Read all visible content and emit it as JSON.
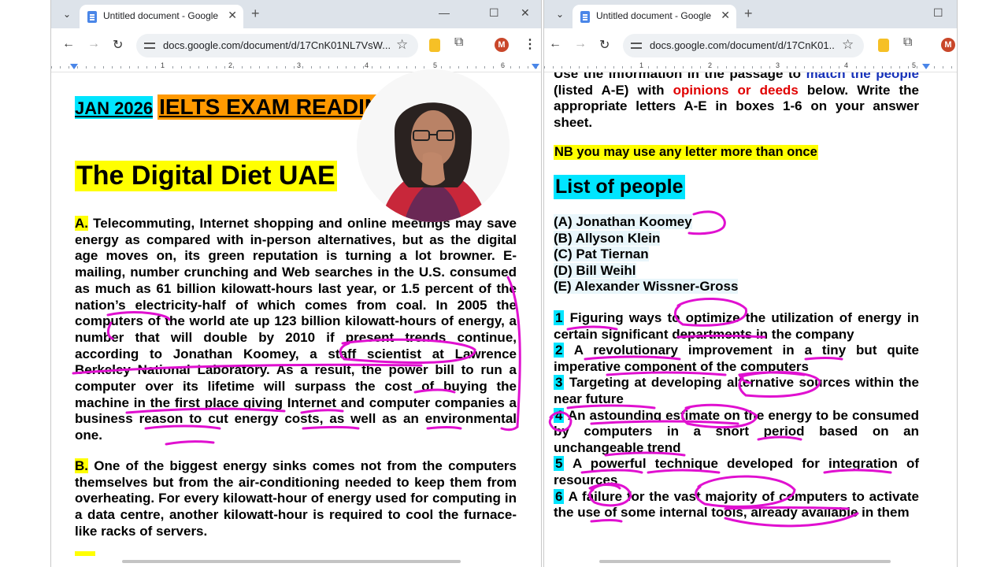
{
  "left_window": {
    "tab_title": "Untitled document - Google Docs",
    "url": "docs.google.com/document/d/17CnK01NL7VsW...",
    "avatar_initial": "M",
    "ruler_numbers": [
      "1",
      "2",
      "3",
      "4",
      "5",
      "6"
    ],
    "document": {
      "exam_date": "JAN 2026",
      "exam_title": "IELTS EXAM READING",
      "title": "The Digital Diet  UAE",
      "paragraph_a_label": "A.",
      "paragraph_a": "Telecommuting, Internet shopping and online meetings may save energy as compared with in-person alternatives, but as the digital age moves on, its green reputation is turning a lot browner. E-mailing, number crunching and Web searches in the U.S. consumed as much as 61 billion kilowatt-hours last year, or 1.5 percent of the nation’s electricity-half of which comes from coal. In 2005 the computers of the world ate up 123 billion kilowatt-hours of energy, a number that will double by 2010 if present trends continue, according to Jonathan Koomey, a staff scientist at Lawrence Berkeley National Laboratory. As a result, the power bill to run a computer over its lifetime will surpass the cost of buying the machine in the first place giving Internet and computer companies a business reason to cut energy costs, as well as an environmental one.",
      "paragraph_b_label": "B.",
      "paragraph_b": "One of the biggest energy sinks comes not from the computers themselves but from the air-conditioning needed to keep them from overheating. For every kilowatt-hour of energy used for computing in a data centre, another kilowatt-hour is required to cool the furnace-like racks of servers."
    }
  },
  "right_window": {
    "tab_title": "Untitled document - Google Docs",
    "url": "docs.google.com/document/d/17CnK01...",
    "avatar_initial": "M",
    "ruler_numbers": [
      "1",
      "2",
      "3",
      "4",
      "5"
    ],
    "document": {
      "instruction": {
        "part1": "Use the information in the passage to",
        "match": "match the",
        "people": "people",
        "part2": "(listed A-E) with",
        "opinions": "opinions or deeds",
        "part3": "below. Write the appropriate letters A-E in boxes 1-6 on your answer sheet."
      },
      "nb_note": "NB you may use any letter more than once",
      "people_heading": "List of people",
      "people": [
        "(A) Jonathan Koomey",
        "(B) Allyson Klein",
        "(C) Pat Tiernan",
        "(D)  Bill Weihl",
        "(E) Alexander Wissner-Gross"
      ],
      "questions": [
        {
          "number": "1",
          "text": "Figuring ways to optimize the utilization of energy in certain significant departments in the company"
        },
        {
          "number": "2",
          "text": "A revolutionary improvement in a tiny but quite imperative component of the computers"
        },
        {
          "number": "3",
          "text": "Targeting at developing alternative sources within the near future"
        },
        {
          "number": "4",
          "text": "An astounding estimate on the energy to be consumed by computers in a short period based on an unchangeable trend"
        },
        {
          "number": "5",
          "text": "A powerful technique developed for integration of resources"
        },
        {
          "number": "6",
          "text": "A failure for the vast majority of computers to activate the use of some internal tools, already available in them"
        }
      ]
    }
  },
  "colors": {
    "highlight_yellow": "#ffff00",
    "highlight_cyan": "#00e5ff",
    "highlight_orange": "#ff9900",
    "pen_magenta": "#e010d0",
    "text_blue": "#1530b8",
    "text_red": "#e00000"
  }
}
